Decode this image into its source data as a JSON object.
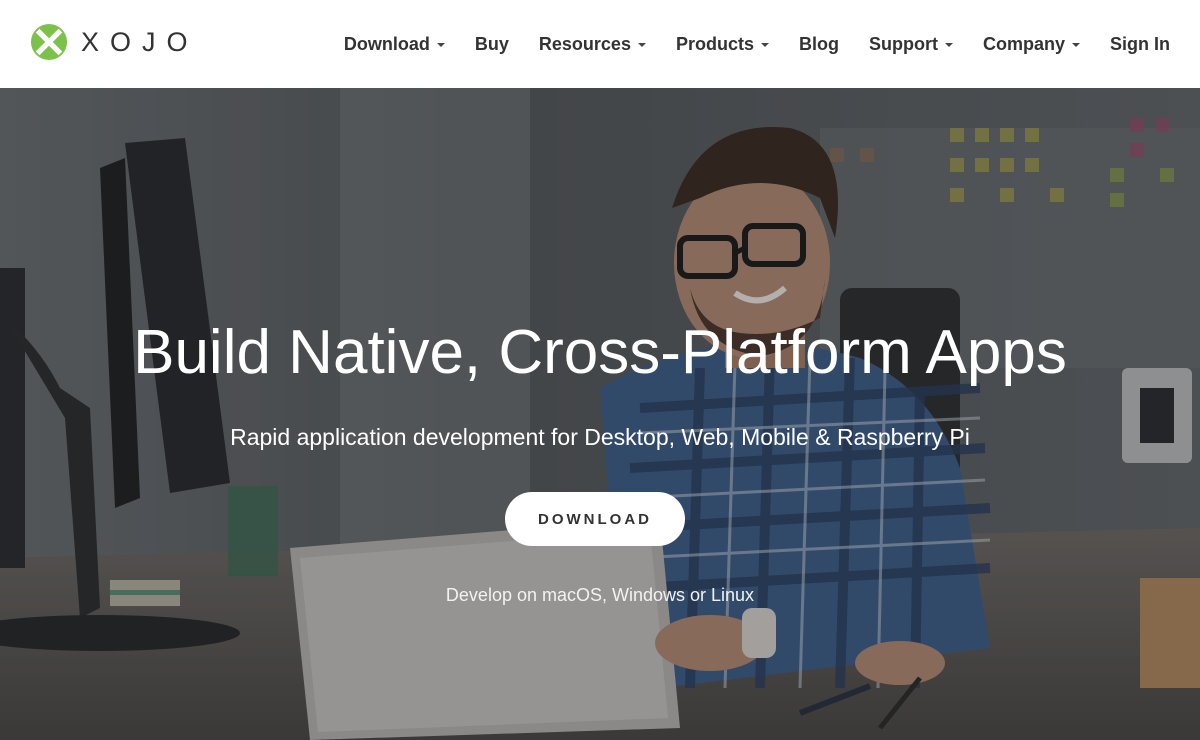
{
  "header": {
    "logo_text": "XOJO",
    "nav": [
      {
        "label": "Download",
        "dropdown": true
      },
      {
        "label": "Buy",
        "dropdown": false
      },
      {
        "label": "Resources",
        "dropdown": true
      },
      {
        "label": "Products",
        "dropdown": true
      },
      {
        "label": "Blog",
        "dropdown": false
      },
      {
        "label": "Support",
        "dropdown": true
      },
      {
        "label": "Company",
        "dropdown": true
      },
      {
        "label": "Sign In",
        "dropdown": false
      }
    ]
  },
  "hero": {
    "title": "Build Native, Cross-Platform Apps",
    "subtitle": "Rapid application development for Desktop, Web, Mobile & Raspberry Pi",
    "button_label": "DOWNLOAD",
    "note": "Develop on macOS, Windows or Linux"
  },
  "colors": {
    "logo_green": "#7cc24a",
    "text_dark": "#333333",
    "white": "#ffffff"
  },
  "icons": {
    "logo": "xojo-x-logo-icon",
    "dropdown": "caret-down-icon"
  }
}
